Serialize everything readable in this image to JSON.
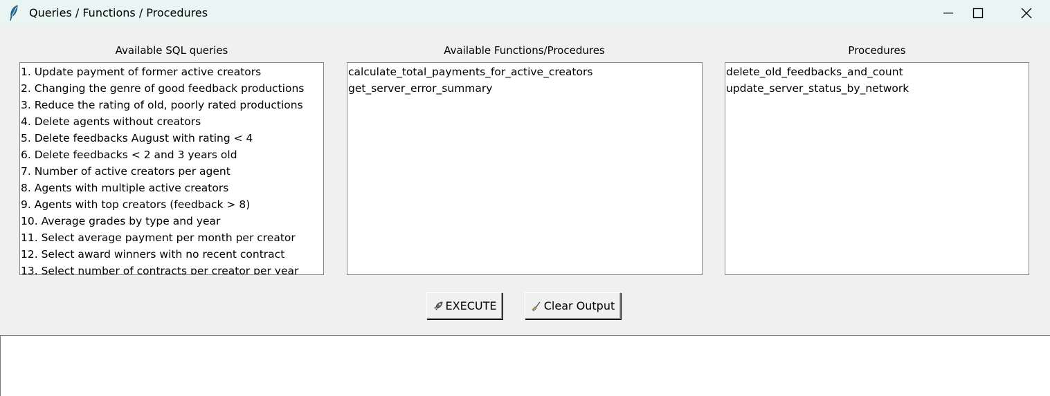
{
  "window": {
    "title": "Queries / Functions / Procedures",
    "icon": "feather-icon"
  },
  "queries_panel": {
    "label": "Available SQL queries",
    "items": [
      "1. Update payment of former active creators",
      "2. Changing the genre of good feedback productions",
      "3. Reduce the rating of old, poorly rated productions",
      "4. Delete agents without creators",
      "5. Delete feedbacks August with rating < 4",
      "6. Delete feedbacks < 2 and 3 years old",
      "7. Number of active creators per agent",
      "8. Agents with multiple active creators",
      "9. Agents with top creators (feedback > 8)",
      "10. Average grades by type and year",
      "11. Select average payment per month per creator",
      "12. Select award winners with no recent contract",
      "13. Select number of contracts per creator per year"
    ]
  },
  "functions_panel": {
    "label": "Available Functions/Procedures",
    "items": [
      "calculate_total_payments_for_active_creators",
      "get_server_error_summary"
    ]
  },
  "procedures_panel": {
    "label": "Procedures",
    "items": [
      "delete_old_feedbacks_and_count",
      "update_server_status_by_network"
    ]
  },
  "buttons": {
    "execute_label": "EXECUTE",
    "execute_icon": "rocket-icon",
    "clear_label": "Clear Output",
    "clear_icon": "broom-icon"
  },
  "output": {
    "text": ""
  }
}
